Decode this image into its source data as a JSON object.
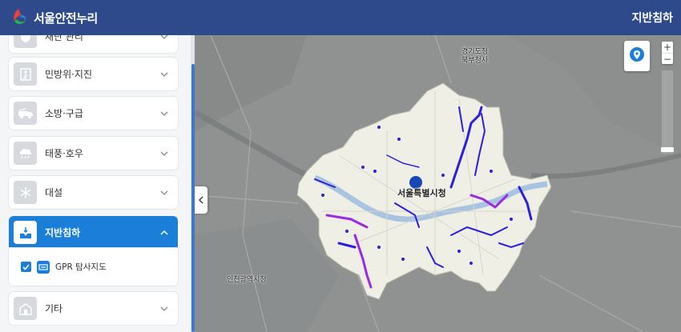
{
  "header": {
    "app_title": "서울안전누리",
    "page_title": "지반침하",
    "logo_colors": [
      "#e9413a",
      "#2bb34b",
      "#2f7fd0"
    ]
  },
  "sidebar": {
    "categories": [
      {
        "label": "재난 관리",
        "icon": "shield-icon"
      },
      {
        "label": "민방위·지진",
        "icon": "evacuation-icon"
      },
      {
        "label": "소방·구급",
        "icon": "fire-truck-icon"
      },
      {
        "label": "태풍·호우",
        "icon": "rain-cloud-icon"
      },
      {
        "label": "대설",
        "icon": "snowflake-icon"
      },
      {
        "label": "지반침하",
        "icon": "sinkhole-icon",
        "expanded": true
      },
      {
        "label": "기타",
        "icon": "building-icon"
      }
    ],
    "sublayers": [
      {
        "label": "GPR 탐사지도",
        "checked": true,
        "icon": "gpr-icon"
      }
    ]
  },
  "map": {
    "labels": {
      "city_hall": "서울특별시청",
      "gyeonggi": "경기도청",
      "gyeonggi2": "북부청사",
      "incheon": "인천광역시청"
    },
    "controls": {
      "zoom_in": "+",
      "zoom_out": "−"
    },
    "colors": {
      "route_blue": "#2a1fe0",
      "route_purple": "#9a2be0",
      "seoul_area": "#efefe6"
    }
  }
}
